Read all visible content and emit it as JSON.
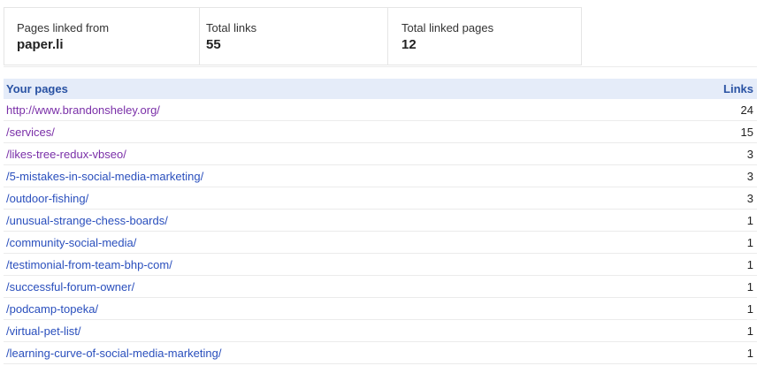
{
  "summary": {
    "linked_from_label": "Pages linked from",
    "linked_from_value": "paper.li",
    "total_links_label": "Total links",
    "total_links_value": "55",
    "total_pages_label": "Total linked pages",
    "total_pages_value": "12"
  },
  "table": {
    "col_pages": "Your pages",
    "col_links": "Links",
    "rows": [
      {
        "page": "http://www.brandonsheley.org/",
        "links": "24",
        "visited": true
      },
      {
        "page": "/services/",
        "links": "15",
        "visited": true
      },
      {
        "page": "/likes-tree-redux-vbseo/",
        "links": "3",
        "visited": true
      },
      {
        "page": "/5-mistakes-in-social-media-marketing/",
        "links": "3",
        "visited": false
      },
      {
        "page": "/outdoor-fishing/",
        "links": "3",
        "visited": false
      },
      {
        "page": "/unusual-strange-chess-boards/",
        "links": "1",
        "visited": false
      },
      {
        "page": "/community-social-media/",
        "links": "1",
        "visited": false
      },
      {
        "page": "/testimonial-from-team-bhp-com/",
        "links": "1",
        "visited": false
      },
      {
        "page": "/successful-forum-owner/",
        "links": "1",
        "visited": false
      },
      {
        "page": "/podcamp-topeka/",
        "links": "1",
        "visited": false
      },
      {
        "page": "/virtual-pet-list/",
        "links": "1",
        "visited": false
      },
      {
        "page": "/learning-curve-of-social-media-marketing/",
        "links": "1",
        "visited": false
      }
    ]
  },
  "colors": {
    "header_bg": "#e5ecf9",
    "header_text": "#2952a3",
    "link": "#2a4fbd",
    "visited_link": "#7a2fa8"
  }
}
